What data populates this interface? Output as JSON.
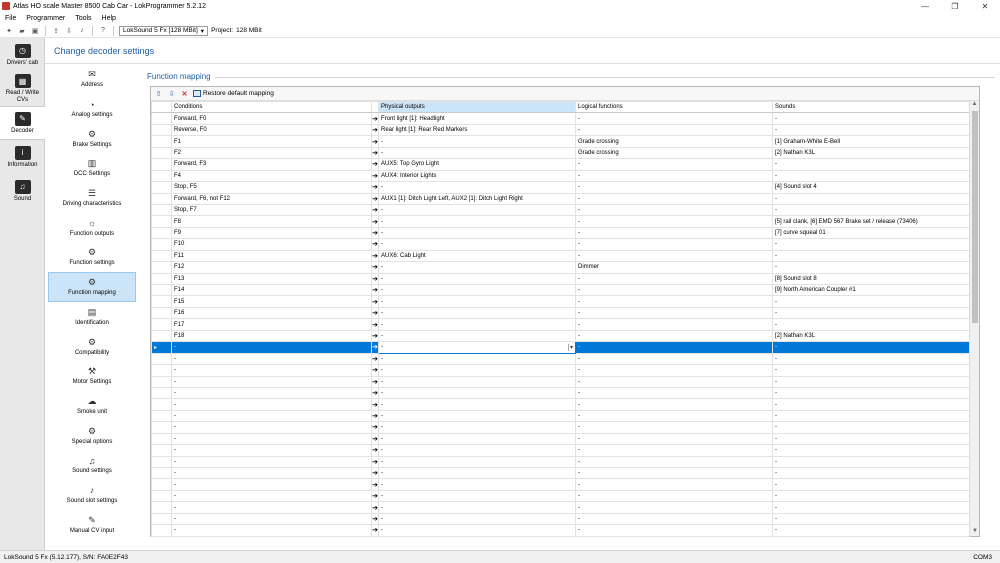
{
  "window": {
    "title": "Atlas HO scale Master 8500 Cab Car - LokProgrammer 5.2.12",
    "controls": [
      "—",
      "❐",
      "✕"
    ]
  },
  "menu": [
    "File",
    "Programmer",
    "Tools",
    "Help"
  ],
  "toolbar": {
    "decoder_select": "LokSound 5 Fx [128 MBit]",
    "project_label": "Project:",
    "project_value": "128 MBit"
  },
  "leftnav": [
    {
      "label": "Drivers' cab",
      "icon": "drivers-cab-icon",
      "active": false
    },
    {
      "label": "Read / Write CVs",
      "icon": "read-write-icon",
      "active": false
    },
    {
      "label": "Decoder",
      "icon": "decoder-icon",
      "active": true
    },
    {
      "label": "Information",
      "icon": "information-icon",
      "active": false
    },
    {
      "label": "Sound",
      "icon": "sound-icon",
      "active": false
    }
  ],
  "page_title": "Change decoder settings",
  "subnav": [
    {
      "label": "Address",
      "icon": "envelope-icon"
    },
    {
      "label": "Analog settings",
      "icon": "analog-icon"
    },
    {
      "label": "Brake Settings",
      "icon": "brake-icon"
    },
    {
      "label": "DCC Settings",
      "icon": "dcc-icon"
    },
    {
      "label": "Driving characteristics",
      "icon": "sliders-icon"
    },
    {
      "label": "Function outputs",
      "icon": "bulb-icon"
    },
    {
      "label": "Function settings",
      "icon": "function-settings-icon"
    },
    {
      "label": "Function mapping",
      "icon": "function-mapping-icon"
    },
    {
      "label": "Identification",
      "icon": "id-card-icon"
    },
    {
      "label": "Compatibility",
      "icon": "compatibility-icon"
    },
    {
      "label": "Motor Settings",
      "icon": "motor-icon"
    },
    {
      "label": "Smoke unit",
      "icon": "smoke-icon"
    },
    {
      "label": "Special options",
      "icon": "special-options-icon"
    },
    {
      "label": "Sound settings",
      "icon": "sound-settings-icon"
    },
    {
      "label": "Sound slot settings",
      "icon": "sound-slot-icon"
    },
    {
      "label": "Manual CV input",
      "icon": "manual-cv-icon"
    }
  ],
  "active_subnav": "Function mapping",
  "section_title": "Function mapping",
  "grid_toolbar": {
    "restore_label": "Restore default mapping"
  },
  "columns": [
    "Conditions",
    "Physical outputs",
    "Logical functions",
    "Sounds"
  ],
  "rows": [
    {
      "cond": "Forward, F0",
      "phys": "Front light [1]: Headlight",
      "logic": "-",
      "sound": "-"
    },
    {
      "cond": "Reverse, F0",
      "phys": "Rear light [1]: Rear Red Markers",
      "logic": "-",
      "sound": "-"
    },
    {
      "cond": "F1",
      "phys": "-",
      "logic": "Grade crossing",
      "sound": "[1] Graham-White E-Bell"
    },
    {
      "cond": "F2",
      "phys": "-",
      "logic": "Grade crossing",
      "sound": "[2] Nathan K3L"
    },
    {
      "cond": "Forward, F3",
      "phys": "AUX5: Top Gyro Light",
      "logic": "-",
      "sound": "-"
    },
    {
      "cond": "F4",
      "phys": "AUX4: Interior Lights",
      "logic": "-",
      "sound": "-"
    },
    {
      "cond": "Stop, F5",
      "phys": "-",
      "logic": "-",
      "sound": "[4] Sound slot 4"
    },
    {
      "cond": "Forward, F6, not F12",
      "phys": "AUX1 [1]: Ditch Light Left, AUX2 [1]: Ditch Light Right",
      "logic": "-",
      "sound": "-"
    },
    {
      "cond": "Stop, F7",
      "phys": "-",
      "logic": "-",
      "sound": "-"
    },
    {
      "cond": "F8",
      "phys": "-",
      "logic": "-",
      "sound": "[5] rail clank, [6] EMD 567 Brake set / release (73406)"
    },
    {
      "cond": "F9",
      "phys": "-",
      "logic": "-",
      "sound": "[7] curve squeal 01"
    },
    {
      "cond": "F10",
      "phys": "-",
      "logic": "-",
      "sound": "-"
    },
    {
      "cond": "F11",
      "phys": "AUX6: Cab Light",
      "logic": "-",
      "sound": "-"
    },
    {
      "cond": "F12",
      "phys": "-",
      "logic": "Dimmer",
      "sound": "-"
    },
    {
      "cond": "F13",
      "phys": "-",
      "logic": "-",
      "sound": "[8] Sound slot 8"
    },
    {
      "cond": "F14",
      "phys": "-",
      "logic": "-",
      "sound": "[9] North American Coupler #1"
    },
    {
      "cond": "F15",
      "phys": "-",
      "logic": "-",
      "sound": "-"
    },
    {
      "cond": "F16",
      "phys": "-",
      "logic": "-",
      "sound": "-"
    },
    {
      "cond": "F17",
      "phys": "-",
      "logic": "-",
      "sound": "-"
    },
    {
      "cond": "F18",
      "phys": "-",
      "logic": "-",
      "sound": "[2] Nathan K3L"
    },
    {
      "cond": "-",
      "phys": "-",
      "logic": "-",
      "sound": "-",
      "selected": true
    },
    {
      "cond": "-",
      "phys": "-",
      "logic": "-",
      "sound": "-"
    },
    {
      "cond": "-",
      "phys": "-",
      "logic": "-",
      "sound": "-"
    },
    {
      "cond": "-",
      "phys": "-",
      "logic": "-",
      "sound": "-"
    },
    {
      "cond": "-",
      "phys": "-",
      "logic": "-",
      "sound": "-"
    },
    {
      "cond": "-",
      "phys": "-",
      "logic": "-",
      "sound": "-"
    },
    {
      "cond": "-",
      "phys": "-",
      "logic": "-",
      "sound": "-"
    },
    {
      "cond": "-",
      "phys": "-",
      "logic": "-",
      "sound": "-"
    },
    {
      "cond": "-",
      "phys": "-",
      "logic": "-",
      "sound": "-"
    },
    {
      "cond": "-",
      "phys": "-",
      "logic": "-",
      "sound": "-"
    },
    {
      "cond": "-",
      "phys": "-",
      "logic": "-",
      "sound": "-"
    },
    {
      "cond": "-",
      "phys": "-",
      "logic": "-",
      "sound": "-"
    },
    {
      "cond": "-",
      "phys": "-",
      "logic": "-",
      "sound": "-"
    },
    {
      "cond": "-",
      "phys": "-",
      "logic": "-",
      "sound": "-"
    },
    {
      "cond": "-",
      "phys": "-",
      "logic": "-",
      "sound": "-"
    },
    {
      "cond": "-",
      "phys": "-",
      "logic": "-",
      "sound": "-"
    },
    {
      "cond": "-",
      "phys": "-",
      "logic": "-",
      "sound": "-"
    }
  ],
  "status": {
    "left": "LokSound 5 Fx (5.12.177), S/N: FA0E2F43",
    "right": "COM3"
  },
  "colors": {
    "selection": "#0078d7",
    "header_accent": "#1f5fa8",
    "active_nav": "#cce4f7"
  }
}
